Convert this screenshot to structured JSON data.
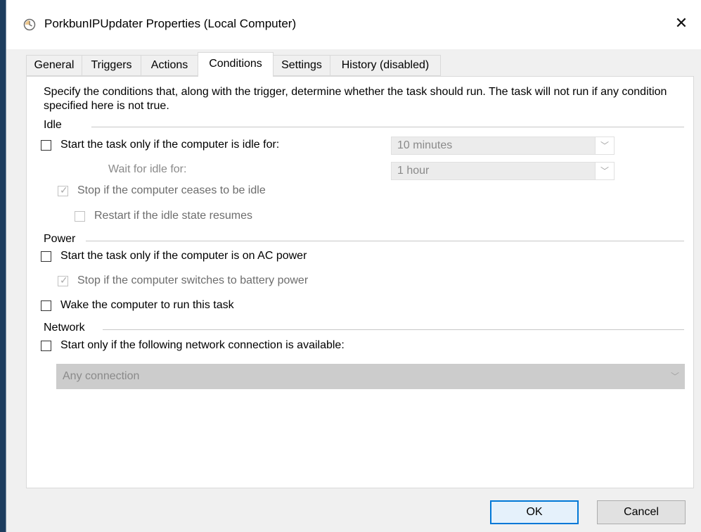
{
  "window": {
    "title": "PorkbunIPUpdater Properties (Local Computer)",
    "close_glyph": "✕",
    "icon": "clock-icon"
  },
  "tabs": [
    {
      "label": "General",
      "active": false
    },
    {
      "label": "Triggers",
      "active": false
    },
    {
      "label": "Actions",
      "active": false
    },
    {
      "label": "Conditions",
      "active": true
    },
    {
      "label": "Settings",
      "active": false
    },
    {
      "label": "History (disabled)",
      "active": false
    }
  ],
  "description": "Specify the conditions that, along with the trigger, determine whether the task should run.  The task will not run  if any condition specified here is not true.",
  "idle": {
    "group_label": "Idle",
    "start_if_idle": {
      "label": "Start the task only if the computer is idle for:",
      "checked": false
    },
    "idle_duration": {
      "value": "10 minutes"
    },
    "wait_label": "Wait for idle for:",
    "wait_duration": {
      "value": "1 hour"
    },
    "stop_if_not_idle": {
      "label": "Stop if the computer ceases to be idle",
      "checked": true
    },
    "restart_if_idle": {
      "label": "Restart if the idle state resumes",
      "checked": false
    }
  },
  "power": {
    "group_label": "Power",
    "ac_power": {
      "label": "Start the task only if the computer is on AC power",
      "checked": false
    },
    "stop_on_battery": {
      "label": "Stop if the computer switches to battery power",
      "checked": true
    },
    "wake": {
      "label": "Wake the computer to run this task",
      "checked": false
    }
  },
  "network": {
    "group_label": "Network",
    "network_available": {
      "label": "Start only if the following network connection is available:",
      "checked": false
    },
    "connection": {
      "value": "Any connection"
    }
  },
  "buttons": {
    "ok": "OK",
    "cancel": "Cancel"
  },
  "colors": {
    "accent": "#0078d7",
    "background": "#f0f0f0",
    "desktop": "#1d3d5e"
  },
  "glyphs": {
    "check": "✓",
    "dropdown": "﹀"
  }
}
